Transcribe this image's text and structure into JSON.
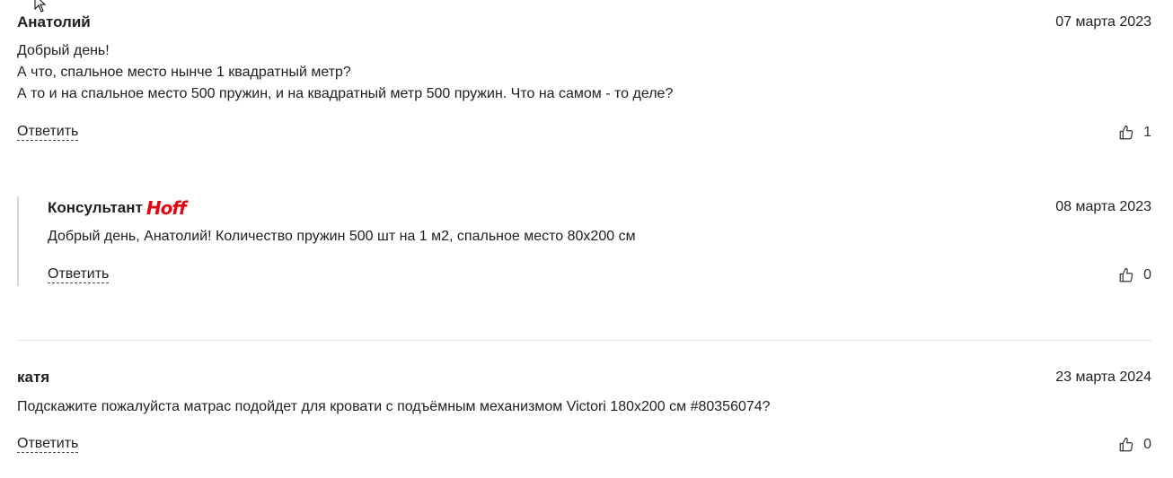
{
  "reviews": [
    {
      "author": "Анатолий",
      "date": "07 марта 2023",
      "text": "Добрый день!\nА что, спальное место нынче 1 квадратный метр?\nА то и на спальное место 500 пружин, и на квадратный метр 500 пружин. Что на самом - то деле?",
      "reply_label": "Ответить",
      "likes": "1",
      "answer": {
        "author": "Консультант",
        "brand": "Hoff",
        "date": "08 марта 2023",
        "text": "Добрый день, Анатолий! Количество пружин 500 шт на 1 м2, спальное место 80х200 см",
        "reply_label": "Ответить",
        "likes": "0"
      }
    },
    {
      "author": "катя",
      "date": "23 марта 2024",
      "text": "Подскажите пожалуйста матрас подойдет для кровати с подъёмным механизмом Victori 180х200 см #80356074?",
      "reply_label": "Ответить",
      "likes": "0"
    }
  ],
  "icons": {
    "like": "thumbs-up-icon",
    "cursor": "mouse-pointer-icon"
  }
}
